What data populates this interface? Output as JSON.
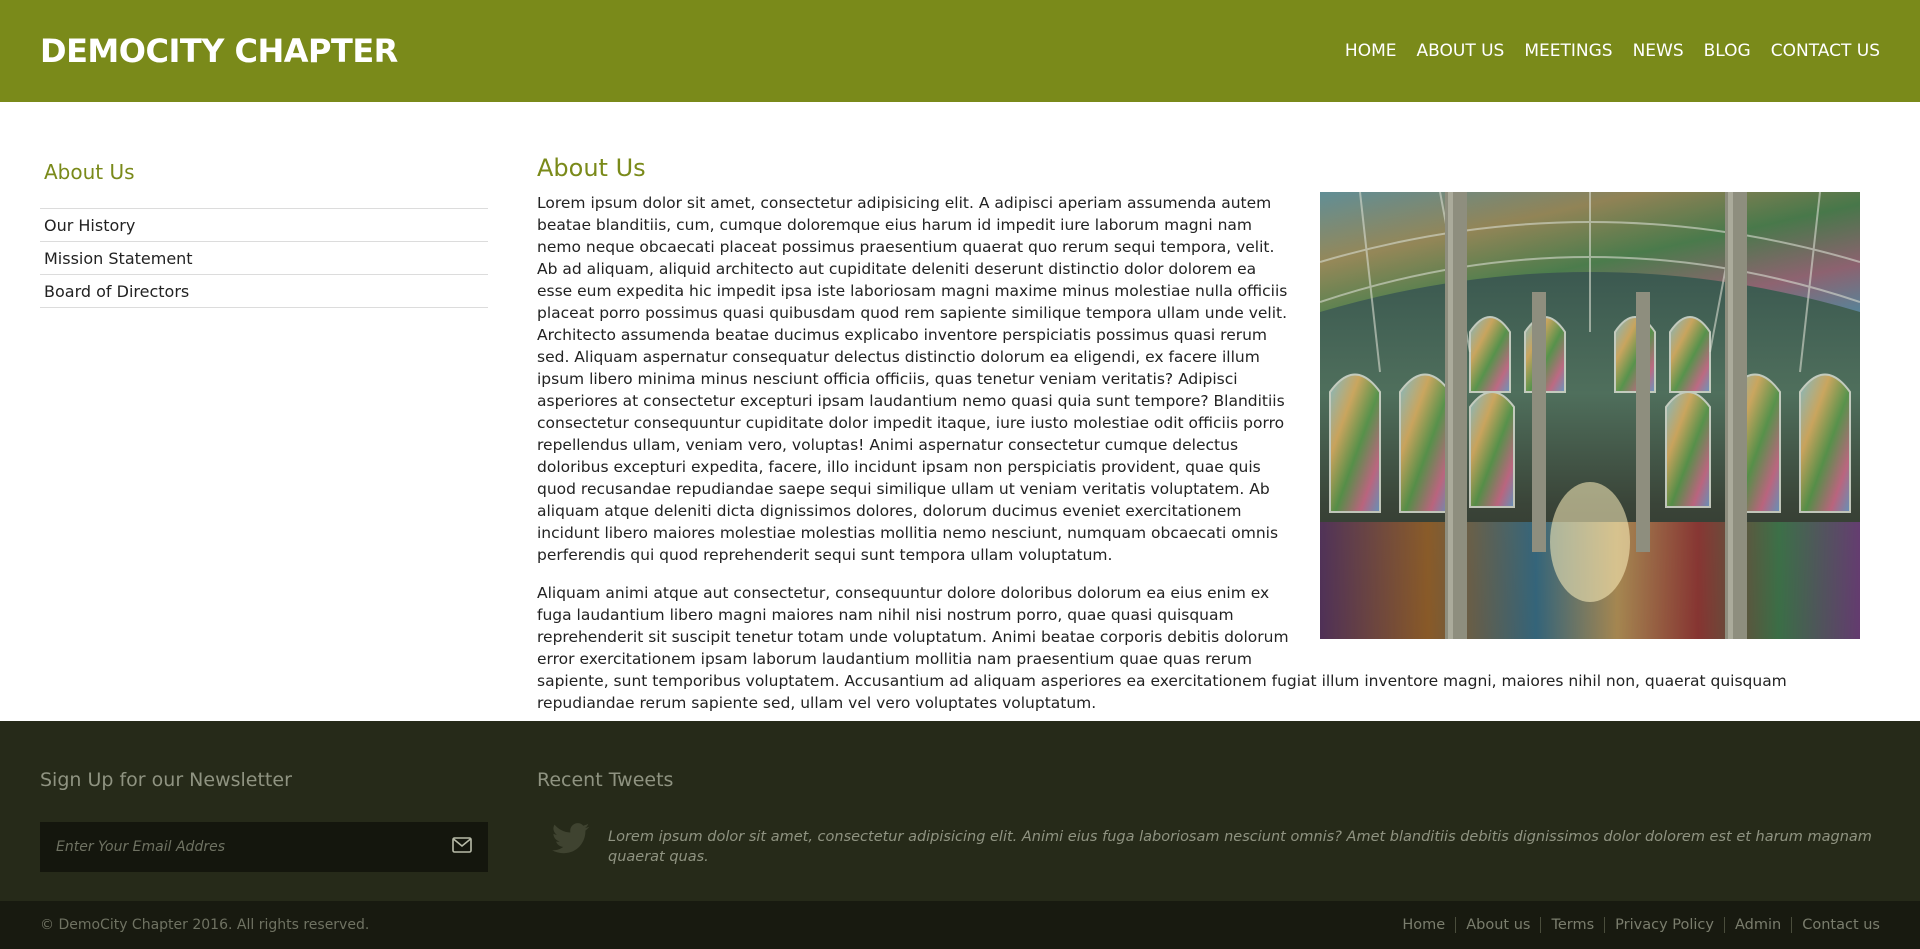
{
  "header": {
    "brand": "DEMOCITY CHAPTER",
    "nav": [
      "HOME",
      "ABOUT US",
      "MEETINGS",
      "NEWS",
      "BLOG",
      "CONTACT US"
    ]
  },
  "sidebar": {
    "title": "About Us",
    "items": [
      "Our History",
      "Mission Statement",
      "Board of Directors"
    ]
  },
  "content": {
    "title": "About Us",
    "paragraph1": "Lorem ipsum dolor sit amet, consectetur adipisicing elit. A adipisci aperiam assumenda autem beatae blanditiis, cum, cumque doloremque eius harum id impedit iure laborum magni nam nemo neque obcaecati placeat possimus praesentium quaerat quo rerum sequi tempora, velit. Ab ad aliquam, aliquid architecto aut cupiditate deleniti deserunt distinctio dolor dolorem ea esse eum expedita hic impedit ipsa iste laboriosam magni maxime minus molestiae nulla officiis placeat porro possimus quasi quibusdam quod rem sapiente similique tempora ullam unde velit. Architecto assumenda beatae ducimus explicabo inventore perspiciatis possimus quasi rerum sed. Aliquam aspernatur consequatur delectus distinctio dolorum ea eligendi, ex facere illum ipsum libero minima minus nesciunt officia officiis, quas tenetur veniam veritatis? Adipisci asperiores at consectetur excepturi ipsam laudantium nemo quasi quia sunt tempore? Blanditiis consectetur consequuntur cupiditate dolor impedit itaque, iure iusto molestiae odit officiis porro repellendus ullam, veniam vero, voluptas! Animi aspernatur consectetur cumque delectus doloribus excepturi expedita, facere, illo incidunt ipsam non perspiciatis provident, quae quis quod recusandae repudiandae saepe sequi similique ullam ut veniam veritatis voluptatem. Ab aliquam atque deleniti dicta dignissimos dolores, dolorum ducimus eveniet exercitationem incidunt libero maiores molestiae molestias mollitia nemo nesciunt, numquam obcaecati omnis perferendis qui quod reprehenderit sequi sunt tempora ullam voluptatum.",
    "paragraph2": "Aliquam animi atque aut consectetur, consequuntur dolore doloribus dolorum ea eius enim ex fuga laudantium libero magni maiores nam nihil nisi nostrum porro, quae quasi quisquam reprehenderit sit suscipit tenetur totam unde voluptatum. Animi beatae corporis debitis dolorum error exercitationem ipsam laborum laudantium mollitia nam praesentium quae quas rerum sapiente, sunt temporibus voluptatem. Accusantium ad aliquam asperiores ea exercitationem fugiat illum inventore magni, maiores nihil non, quaerat quisquam repudiandae rerum sapiente sed, ullam vel vero voluptates voluptatum."
  },
  "footer": {
    "newsletter_title": "Sign Up for our Newsletter",
    "email_placeholder": "Enter Your Email Addres",
    "send_icon": "envelope-icon",
    "tweets_title": "Recent Tweets",
    "tweet_icon": "twitter-bird-icon",
    "tweet_text": "Lorem ipsum dolor sit amet, consectetur adipisicing elit. Animi eius fuga laboriosam nesciunt omnis? Amet blanditiis debitis dignissimos dolor dolorem est et harum magnam quaerat quas.",
    "copyright": "© DemoCity Chapter 2016. All rights reserved.",
    "links": [
      "Home",
      "About us",
      "Terms",
      "Privacy Policy",
      "Admin",
      "Contact us"
    ]
  },
  "colors": {
    "brand": "#7a8a1a",
    "footer_bg": "#262a19",
    "bottom_bg": "#181a10"
  }
}
